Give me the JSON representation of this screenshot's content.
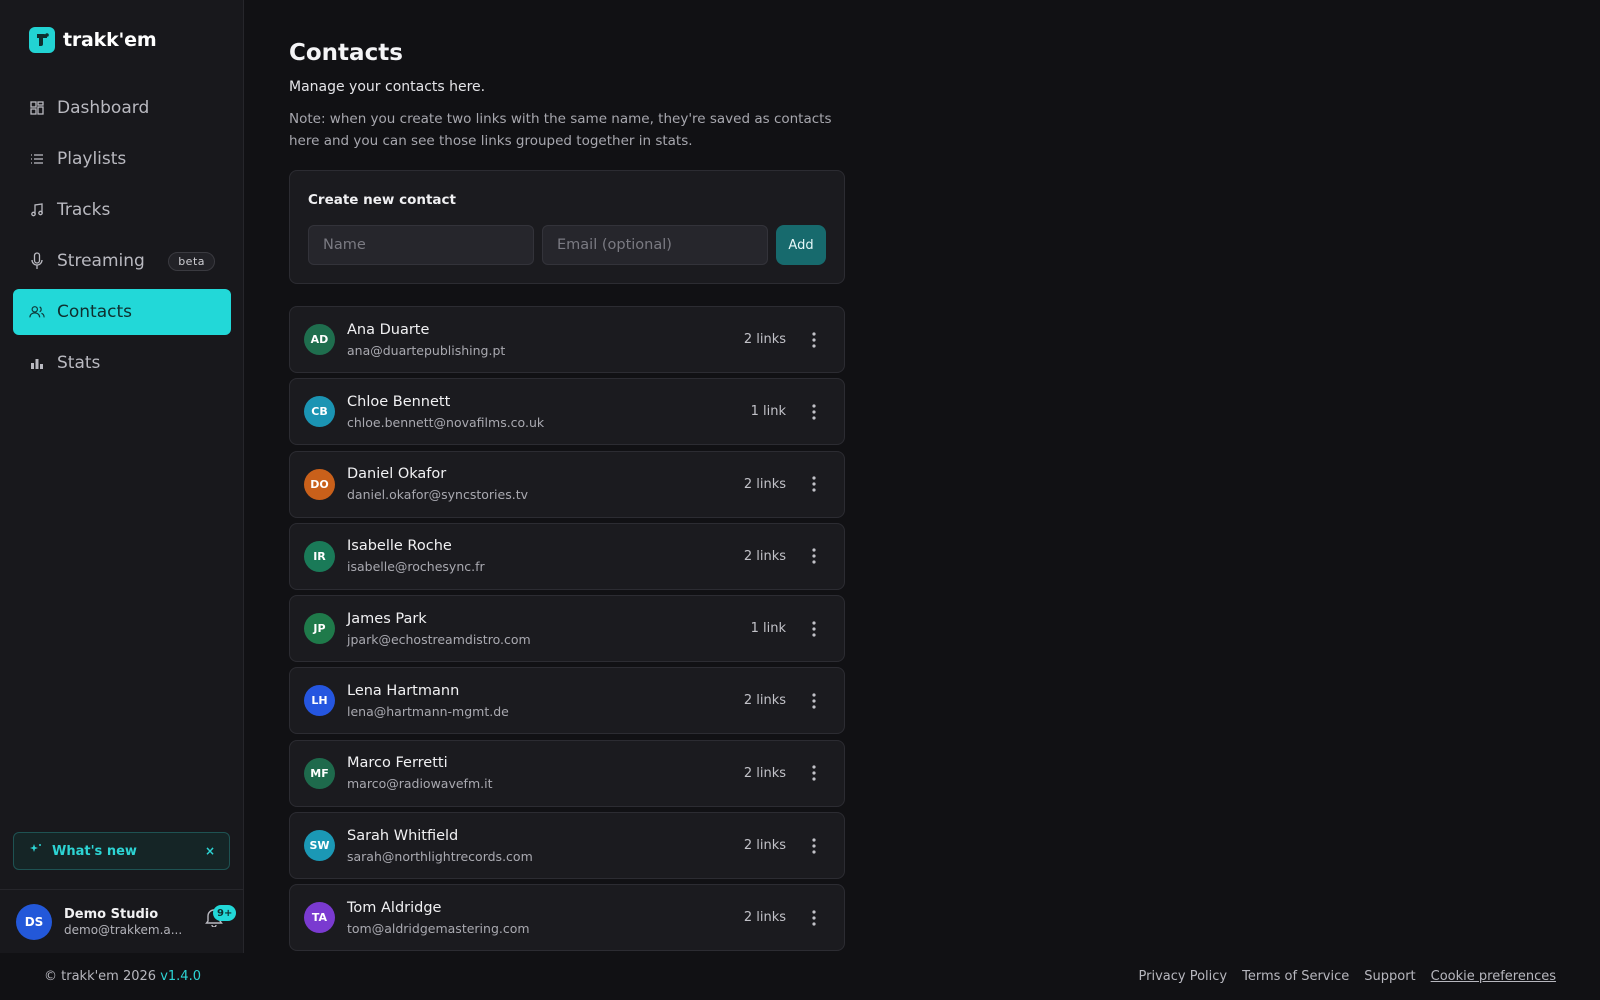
{
  "app": {
    "name": "trakk'em"
  },
  "sidebar": {
    "items": [
      {
        "label": "Dashboard",
        "icon": "dashboard-grid-icon"
      },
      {
        "label": "Playlists",
        "icon": "list-icon"
      },
      {
        "label": "Tracks",
        "icon": "music-note-icon"
      },
      {
        "label": "Streaming",
        "icon": "microphone-icon",
        "badge": "beta"
      },
      {
        "label": "Contacts",
        "icon": "users-icon",
        "active": true
      },
      {
        "label": "Stats",
        "icon": "bar-chart-icon"
      }
    ],
    "whats_new": "What's new",
    "close_glyph": "×",
    "user": {
      "initials": "DS",
      "name": "Demo Studio",
      "email": "demo@trakkem.a...",
      "notifications": "9+"
    }
  },
  "page": {
    "title": "Contacts",
    "subtitle": "Manage your contacts here.",
    "note": "Note: when you create two links with the same name, they're saved as contacts here and you can see those links grouped together in stats."
  },
  "create": {
    "title": "Create new contact",
    "name_placeholder": "Name",
    "email_placeholder": "Email (optional)",
    "add_label": "Add"
  },
  "contacts": [
    {
      "initials": "AD",
      "name": "Ana Duarte",
      "email": "ana@duartepublishing.pt",
      "links": "2 links",
      "color": "#1f6e4e"
    },
    {
      "initials": "CB",
      "name": "Chloe Bennett",
      "email": "chloe.bennett@novafilms.co.uk",
      "links": "1 link",
      "color": "#1b94b3"
    },
    {
      "initials": "DO",
      "name": "Daniel Okafor",
      "email": "daniel.okafor@syncstories.tv",
      "links": "2 links",
      "color": "#c9601a"
    },
    {
      "initials": "IR",
      "name": "Isabelle Roche",
      "email": "isabelle@rochesync.fr",
      "links": "2 links",
      "color": "#1a7a58"
    },
    {
      "initials": "JP",
      "name": "James Park",
      "email": "jpark@echostreamdistro.com",
      "links": "1 link",
      "color": "#1f7a4a"
    },
    {
      "initials": "LH",
      "name": "Lena Hartmann",
      "email": "lena@hartmann-mgmt.de",
      "links": "2 links",
      "color": "#2556e0"
    },
    {
      "initials": "MF",
      "name": "Marco Ferretti",
      "email": "marco@radiowavefm.it",
      "links": "2 links",
      "color": "#1e6a4c"
    },
    {
      "initials": "SW",
      "name": "Sarah Whitfield",
      "email": "sarah@northlightrecords.com",
      "links": "2 links",
      "color": "#1b98b5"
    },
    {
      "initials": "TA",
      "name": "Tom Aldridge",
      "email": "tom@aldridgemastering.com",
      "links": "2 links",
      "color": "#7a3ad0"
    }
  ],
  "footer": {
    "copyright": "© trakk'em 2026",
    "version": "v1.4.0",
    "links": [
      "Privacy Policy",
      "Terms of Service",
      "Support",
      "Cookie preferences"
    ]
  },
  "colors": {
    "accent": "#22d8d8",
    "background": "#111114",
    "card": "#1b1b1f"
  }
}
